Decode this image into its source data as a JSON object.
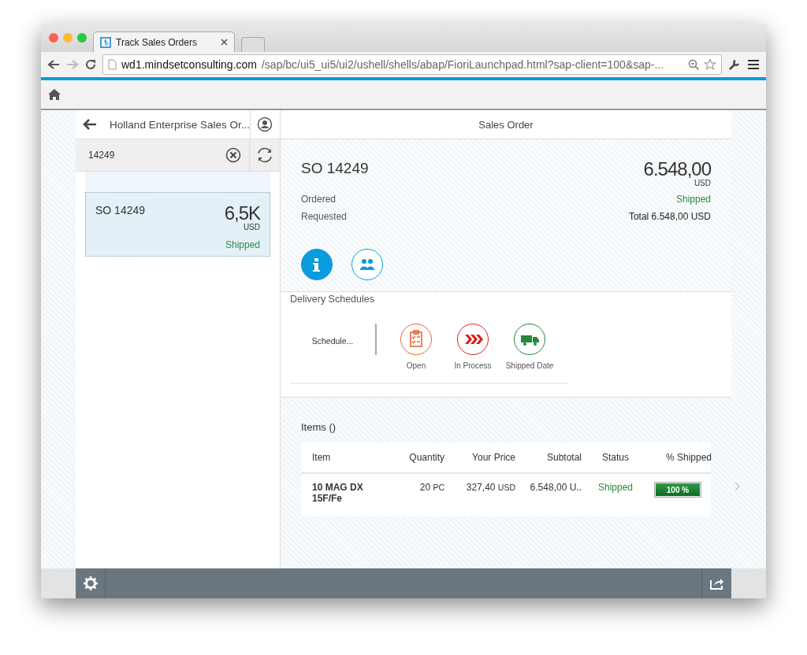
{
  "browser": {
    "tab_title": "Track Sales Orders",
    "url_host": "wd1.mindsetconsulting.com",
    "url_path": "/sap/bc/ui5_ui5/ui2/ushell/shells/abap/FioriLaunchpad.html?sap-client=100&sap-..."
  },
  "master": {
    "title": "Holland Enterprise Sales Or...",
    "search": {
      "value": "14249"
    },
    "items": [
      {
        "title": "SO 14249",
        "amount": "6,5K",
        "currency": "USD",
        "status": "Shipped",
        "selected": true
      }
    ]
  },
  "detail": {
    "title": "Sales Order",
    "header": {
      "title": "SO 14249",
      "amount": "6.548,00",
      "currency": "USD",
      "attributes": [
        {
          "label": "Ordered",
          "value": "Shipped",
          "kind": "status"
        },
        {
          "label": "Requested",
          "value": "Total 6.548,00 USD",
          "kind": "plain"
        }
      ]
    },
    "icon_tabs": [
      {
        "kind": "info",
        "selected": true
      },
      {
        "kind": "people",
        "selected": false
      }
    ],
    "section_title": "Delivery Schedules",
    "schedule": {
      "label": "Schedule...",
      "steps": [
        {
          "kind": "clipboard",
          "label": "Open",
          "color": "#e9643d"
        },
        {
          "kind": "chevrons",
          "label": "In Process",
          "color": "#d81e1e"
        },
        {
          "kind": "truck",
          "label": "Shipped Date",
          "color": "#23883b"
        }
      ]
    },
    "items_table": {
      "title": "Items ()",
      "columns": [
        "Item",
        "Quantity",
        "Your Price",
        "Subtotal",
        "Status",
        "% Shipped"
      ],
      "rows": [
        {
          "item": "10 MAG DX 15F/Fe",
          "quantity": "20",
          "quantity_unit": "PC",
          "price": "327,40",
          "price_unit": "USD",
          "subtotal": "6.548,00 U..",
          "status": "Shipped",
          "shipped": {
            "level": 1,
            "label": "100 %"
          }
        }
      ]
    }
  }
}
